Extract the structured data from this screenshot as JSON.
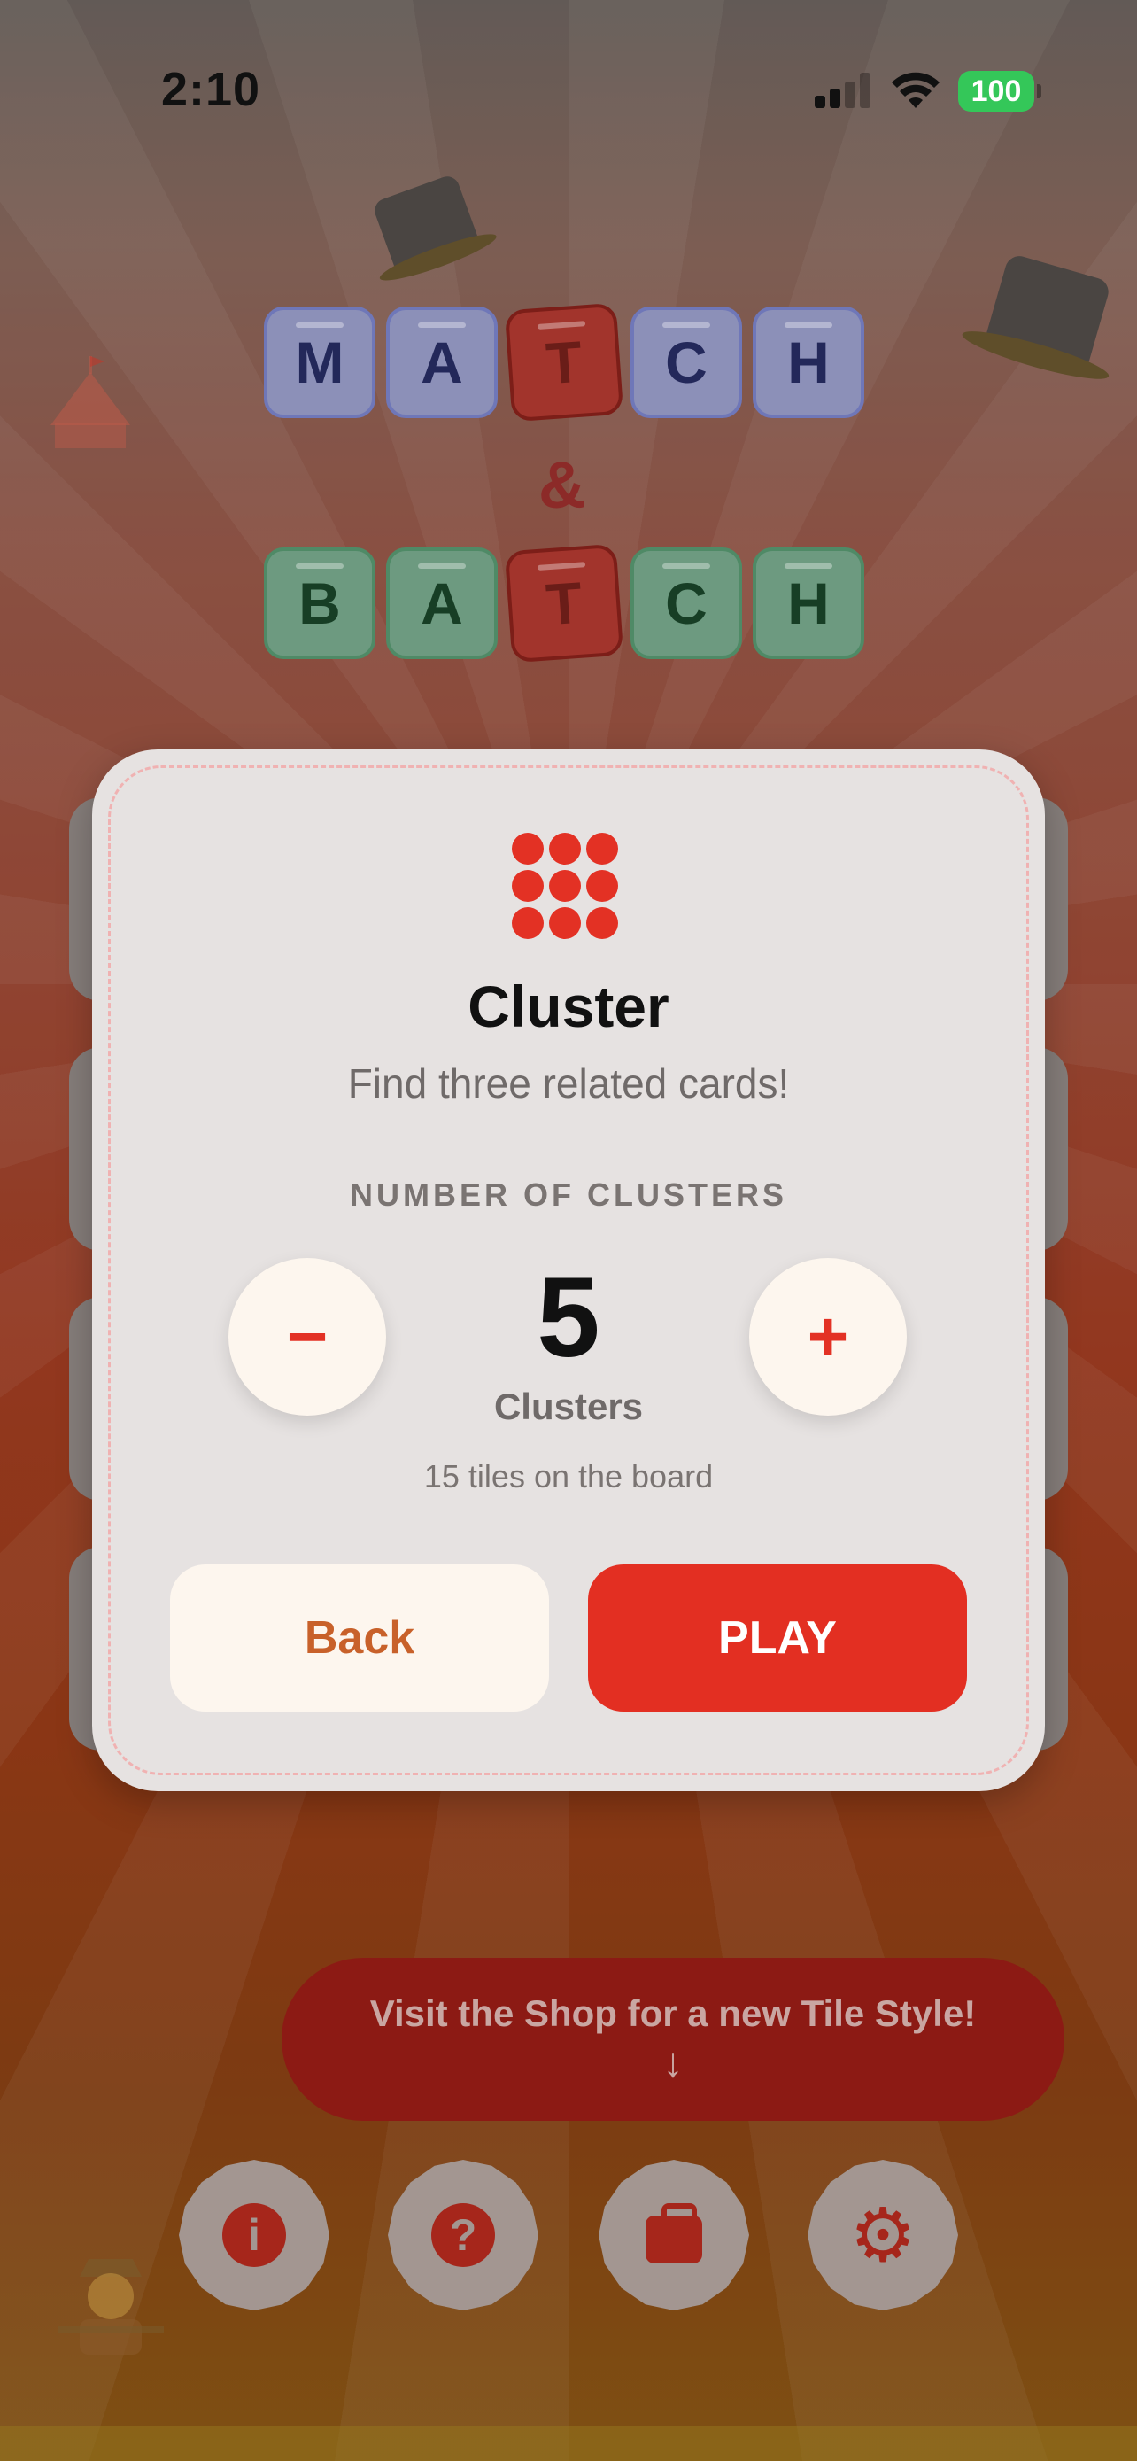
{
  "status_bar": {
    "time": "2:10",
    "battery": "100"
  },
  "logo": {
    "top_word": [
      "M",
      "A",
      "T",
      "C",
      "H"
    ],
    "ampersand": "&",
    "bottom_word": [
      "B",
      "A",
      "T",
      "C",
      "H"
    ]
  },
  "modal": {
    "title": "Cluster",
    "subtitle": "Find three related cards!",
    "section_label": "NUMBER OF CLUSTERS",
    "count": "5",
    "count_unit": "Clusters",
    "tiles_note": "15 tiles on the board",
    "minus_symbol": "−",
    "plus_symbol": "+",
    "back_label": "Back",
    "play_label": "PLAY"
  },
  "shop_banner": {
    "text": "Visit the Shop for a new Tile Style!",
    "arrow": "↓"
  },
  "bottom_nav": {
    "info_glyph": "i",
    "help_glyph": "?",
    "settings_glyph": "⚙"
  },
  "icons": [
    "hat-icon",
    "circus-tent-icon",
    "scarecrow-icon",
    "info-icon",
    "help-icon",
    "shop-bag-icon",
    "settings-gear-icon",
    "cluster-dots-icon"
  ],
  "colors": {
    "accent_red": "#e33124",
    "back_text": "#c8612a",
    "battery_green": "#34c759",
    "modal_bg": "#e6e2e1"
  }
}
